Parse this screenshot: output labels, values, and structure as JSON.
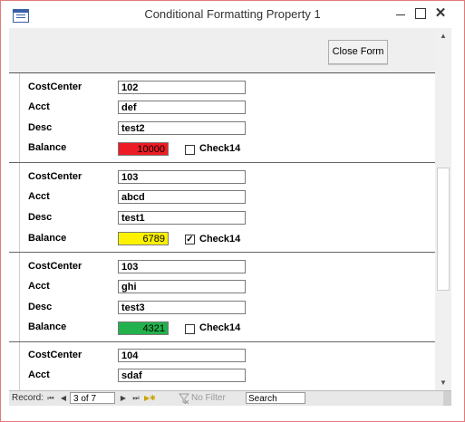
{
  "window": {
    "title": "Conditional Formatting Property 1"
  },
  "header": {
    "close_form_label": "Close Form"
  },
  "records": [
    {
      "costcenter_label": "CostCenter",
      "costcenter": "102",
      "acct_label": "Acct",
      "acct": "def",
      "desc_label": "Desc",
      "desc": "test2",
      "balance_label": "Balance",
      "balance": "10000",
      "balance_color": "#ed1c24",
      "check_label": "Check14",
      "checked": false
    },
    {
      "costcenter_label": "CostCenter",
      "costcenter": "103",
      "acct_label": "Acct",
      "acct": "abcd",
      "desc_label": "Desc",
      "desc": "test1",
      "balance_label": "Balance",
      "balance": "6789",
      "balance_color": "#fff200",
      "check_label": "Check14",
      "checked": true
    },
    {
      "costcenter_label": "CostCenter",
      "costcenter": "103",
      "acct_label": "Acct",
      "acct": "ghi",
      "desc_label": "Desc",
      "desc": "test3",
      "balance_label": "Balance",
      "balance": "4321",
      "balance_color": "#22b14c",
      "check_label": "Check14",
      "checked": false
    },
    {
      "costcenter_label": "CostCenter",
      "costcenter": "104",
      "acct_label": "Acct",
      "acct": "sdaf"
    }
  ],
  "navigation": {
    "record_label": "Record:",
    "current": "3 of 7",
    "filter_label": "No Filter",
    "search_label": "Search"
  },
  "icons": {
    "first": "first-record-icon",
    "prev": "previous-record-icon",
    "next": "next-record-icon",
    "last": "last-record-icon",
    "new": "new-record-icon",
    "filter": "filter-icon"
  }
}
